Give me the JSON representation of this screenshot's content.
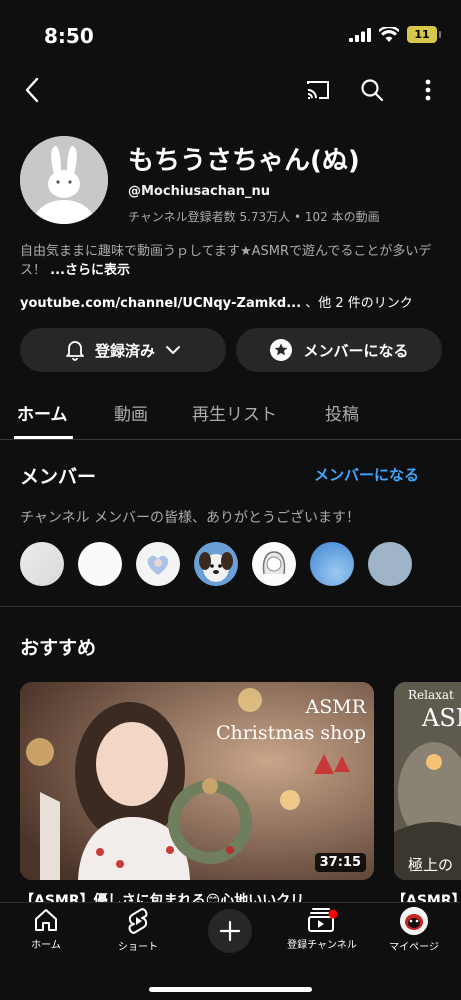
{
  "status": {
    "time": "8:50",
    "battery": "11"
  },
  "channel": {
    "name": "もちうさちゃん(ぬ)",
    "handle": "@Mochiusachan_nu",
    "stats": "チャンネル登録者数 5.73万人 • 102 本の動画",
    "description": "自由気ままに趣味で動画うｐしてます★ASMRで遊んでることが多いデス！",
    "more": "...さらに表示",
    "link_url": "youtube.com/channel/UCNqy-Zamkd...",
    "link_more": "、他 2 件のリンク"
  },
  "buttons": {
    "subscribed": "登録済み",
    "join": "メンバーになる"
  },
  "tabs": [
    {
      "label": "ホーム"
    },
    {
      "label": "動画"
    },
    {
      "label": "再生リスト"
    },
    {
      "label": "投稿"
    }
  ],
  "members": {
    "title": "メンバー",
    "join_link": "メンバーになる",
    "thanks": "チャンネル メンバーの皆様、ありがとうございます！"
  },
  "recommended": {
    "title": "おすすめ",
    "videos": [
      {
        "title": "【ASMR】優しさに包まれる😊心地いいクリ...",
        "duration": "37:15",
        "overlay_line1": "ASMR",
        "overlay_line2": "Christmas shop"
      },
      {
        "title": "【ASMR】",
        "overlay_line1": "Relaxat",
        "overlay_line2": "ASM",
        "overlay_line3": "極上の"
      }
    ]
  },
  "bottom_nav": [
    {
      "label": "ホーム",
      "icon": "home-icon"
    },
    {
      "label": "ショート",
      "icon": "shorts-icon"
    },
    {
      "label": "",
      "icon": "create-plus-icon"
    },
    {
      "label": "登録チャンネル",
      "icon": "subscriptions-icon"
    },
    {
      "label": "マイページ",
      "icon": "profile-avatar"
    }
  ],
  "colors": {
    "background": "#0f0f0f",
    "accent_link": "#3ea6ff",
    "pill": "#272727",
    "battery": "#d8c64a",
    "notification_dot": "#ff0000"
  }
}
